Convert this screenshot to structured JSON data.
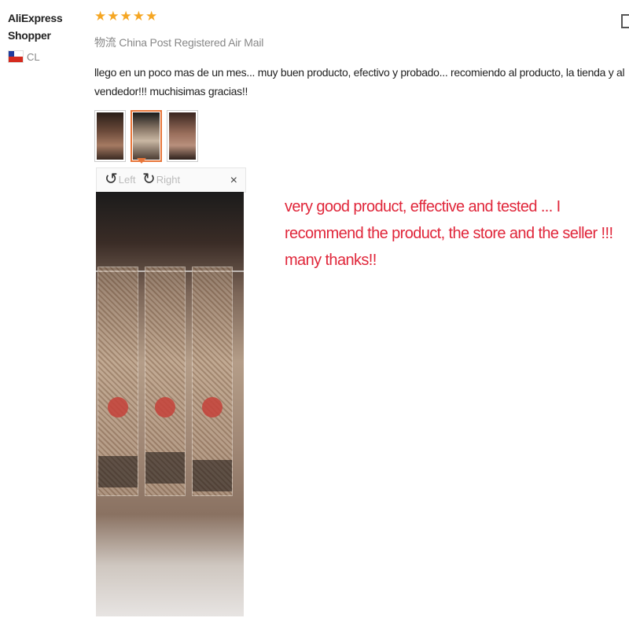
{
  "reviewer": {
    "name": "AliExpress Shopper",
    "country_code": "CL",
    "flag": "chile-flag-icon"
  },
  "review": {
    "stars": [
      "★",
      "★",
      "★",
      "★",
      "★"
    ],
    "star_color": "#f5a623",
    "shipping": "物流 China Post Registered Air Mail",
    "text": "llego en un poco mas de un mes... muy buen producto, efectivo y probado... recomiendo al producto, la tienda y al vendedor!!! muchisimas gracias!!"
  },
  "viewer": {
    "thumbnail_count": 3,
    "selected_thumbnail": 2,
    "rotate_left_label": "Left",
    "rotate_right_label": "Right",
    "close_label": "×"
  },
  "translation": {
    "text": "very good product, effective and tested ... I recommend the product, the store and the seller !!! many thanks!!",
    "color": "#e0263a"
  },
  "accent_color": "#e8763a"
}
